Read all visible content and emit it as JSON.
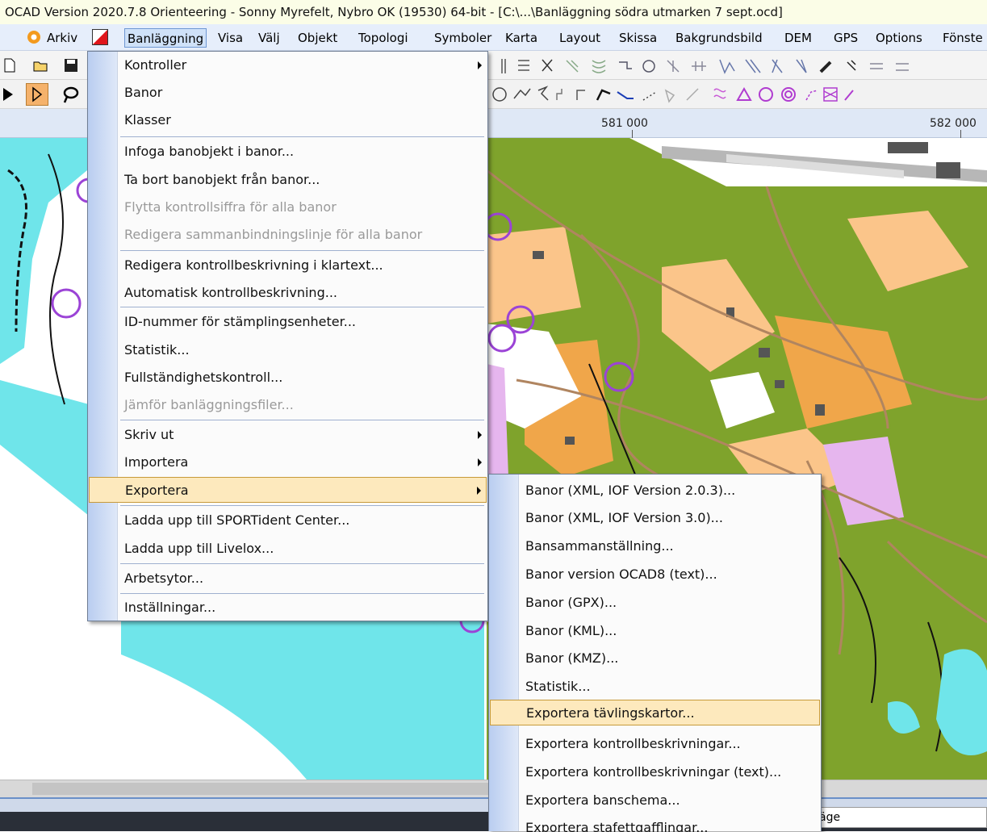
{
  "window": {
    "title": "OCAD Version 2020.7.8 Orienteering - Sonny Myrefelt, Nybro OK (19530) 64-bit - [C:\\...\\Banläggning södra utmarken 7 sept.ocd]"
  },
  "menubar": {
    "items": [
      "Arkiv",
      "Banläggning",
      "Visa",
      "Välj",
      "Objekt",
      "Topologi",
      "Symboler",
      "Karta",
      "Layout",
      "Skissa",
      "Bakgrundsbild",
      "DEM",
      "GPS",
      "Options",
      "Fönste"
    ]
  },
  "ruler": {
    "labels": [
      "581 000",
      "582 000"
    ]
  },
  "main_menu": {
    "items": [
      {
        "label": "Kontroller",
        "submenu": true
      },
      {
        "label": "Banor"
      },
      {
        "label": "Klasser"
      },
      {
        "label": "Infoga banobjekt i banor..."
      },
      {
        "label": "Ta bort banobjekt från banor..."
      },
      {
        "label": "Flytta kontrollsiffra för alla banor",
        "disabled": true
      },
      {
        "label": "Redigera sammanbindningslinje för alla banor",
        "disabled": true
      },
      {
        "label": "Redigera kontrollbeskrivning i klartext..."
      },
      {
        "label": "Automatisk kontrollbeskrivning..."
      },
      {
        "label": "ID-nummer för stämplingsenheter..."
      },
      {
        "label": "Statistik..."
      },
      {
        "label": "Fullständighetskontroll..."
      },
      {
        "label": "Jämför banläggningsfiler...",
        "disabled": true
      },
      {
        "label": "Skriv ut",
        "submenu": true
      },
      {
        "label": "Importera",
        "submenu": true
      },
      {
        "label": "Exportera",
        "submenu": true,
        "highlight": true
      },
      {
        "label": "Ladda upp till SPORTident Center..."
      },
      {
        "label": "Ladda upp till Livelox..."
      },
      {
        "label": "Arbetsytor..."
      },
      {
        "label": "Inställningar..."
      }
    ]
  },
  "export_menu": {
    "items": [
      {
        "label": "Banor (XML, IOF Version 2.0.3)..."
      },
      {
        "label": "Banor (XML, IOF Version 3.0)..."
      },
      {
        "label": "Bansammanställning..."
      },
      {
        "label": "Banor version OCAD8 (text)..."
      },
      {
        "label": "Banor (GPX)..."
      },
      {
        "label": "Banor (KML)..."
      },
      {
        "label": "Banor (KMZ)..."
      },
      {
        "label": "Statistik..."
      },
      {
        "label": "Exportera tävlingskartor...",
        "highlight": true
      },
      {
        "label": "Exportera kontrollbeskrivningar..."
      },
      {
        "label": "Exportera kontrollbeskrivningar (text)..."
      },
      {
        "label": "Exportera banschema..."
      },
      {
        "label": "Exportera stafettgafflingar..."
      }
    ]
  },
  "status": {
    "field_text": "äge"
  },
  "colors": {
    "map_green": "#7fa32c",
    "map_orange": "#f0a64a",
    "map_cyan": "#6fe5ea",
    "control_purple": "#9b43d6",
    "menu_highlight": "#fde9bd"
  }
}
